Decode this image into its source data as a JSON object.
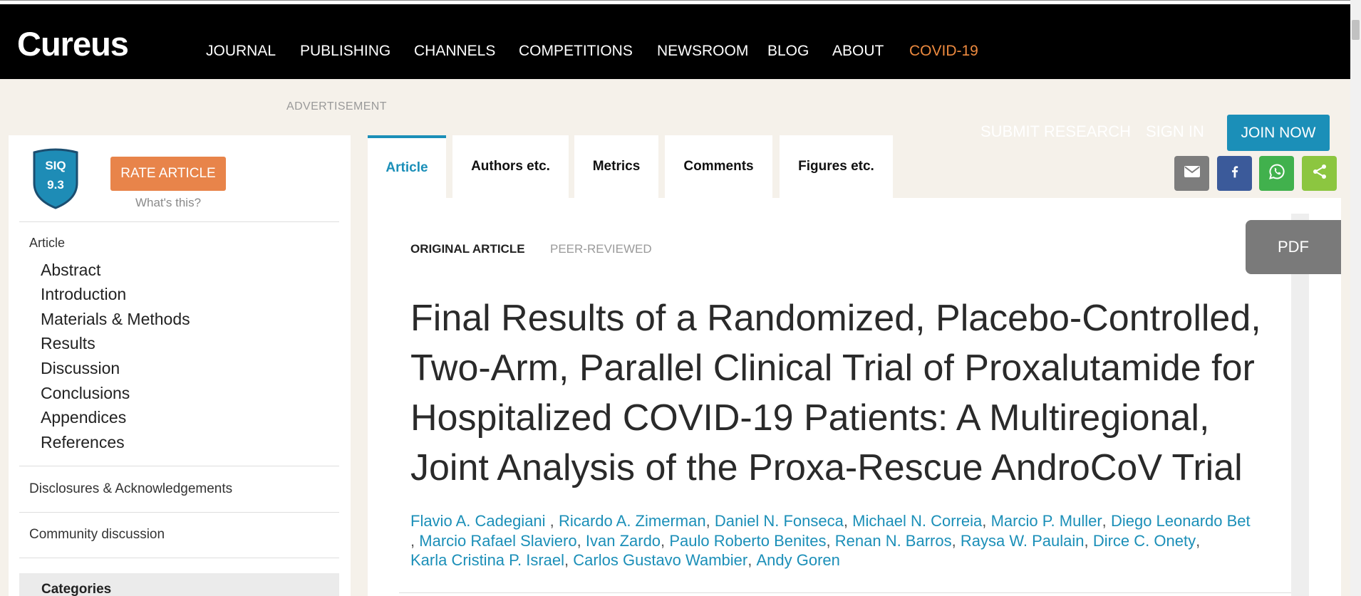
{
  "header": {
    "logo": "Cureus",
    "nav": [
      "JOURNAL",
      "PUBLISHING",
      "CHANNELS",
      "COMPETITIONS",
      "NEWSROOM",
      "BLOG",
      "ABOUT",
      "COVID-19"
    ]
  },
  "ad_label": "ADVERTISEMENT",
  "account": {
    "submit_research": "SUBMIT RESEARCH",
    "sign_in": "SIGN IN",
    "join_now": "JOIN NOW"
  },
  "share": [
    {
      "icon": "email-icon",
      "color": "#7d7d7d"
    },
    {
      "icon": "facebook-icon",
      "color": "#3b5a9a"
    },
    {
      "icon": "whatsapp-icon",
      "color": "#41b14d"
    },
    {
      "icon": "share-icon",
      "color": "#8cc640"
    }
  ],
  "pdf_label": "PDF",
  "sidebar": {
    "siq": {
      "label": "SIQ",
      "score": "9.3"
    },
    "rate_button": "RATE ARTICLE",
    "whats_this": "What's this?",
    "toc_heading": "Article",
    "toc_items": [
      "Abstract",
      "Introduction",
      "Materials & Methods",
      "Results",
      "Discussion",
      "Conclusions",
      "Appendices",
      "References"
    ],
    "links": [
      "Disclosures & Acknowledgements",
      "Community discussion"
    ],
    "categories_heading": "Categories"
  },
  "tabs": [
    {
      "label": "Article",
      "active": true
    },
    {
      "label": "Authors etc.",
      "active": false
    },
    {
      "label": "Metrics",
      "active": false
    },
    {
      "label": "Comments",
      "active": false
    },
    {
      "label": "Figures etc.",
      "active": false
    }
  ],
  "article": {
    "type": "ORIGINAL ARTICLE",
    "review_status": "PEER-REVIEWED",
    "title": "Final Results of a Randomized, Placebo-Controlled, Two-Arm, Parallel Clinical Trial of Proxalutamide for Hospitalized COVID-19 Patients: A Multiregional, Joint Analysis of the Proxa-Rescue AndroCoV Trial",
    "authors": [
      {
        "name": "Flavio A. Cadegiani",
        "sep": " ,"
      },
      {
        "name": "Ricardo A. Zimerman",
        "sep": ","
      },
      {
        "name": "Daniel N. Fonseca",
        "sep": ","
      },
      {
        "name": "Michael N. Correia",
        "sep": ","
      },
      {
        "name": "Marcio P. Muller",
        "sep": ","
      },
      {
        "name": "Diego Leonardo Bet",
        "sep": ","
      },
      {
        "name": "Marcio Rafael Slaviero",
        "sep": ","
      },
      {
        "name": "Ivan Zardo",
        "sep": ","
      },
      {
        "name": "Paulo Roberto Benites",
        "sep": ","
      },
      {
        "name": "Renan N. Barros",
        "sep": ","
      },
      {
        "name": "Raysa W. Paulain",
        "sep": ","
      },
      {
        "name": "Dirce C. Onety",
        "sep": ","
      },
      {
        "name": "Karla Cristina P. Israel",
        "sep": ","
      },
      {
        "name": "Carlos Gustavo Wambier",
        "sep": ","
      },
      {
        "name": "Andy Goren",
        "sep": ""
      }
    ]
  },
  "colors": {
    "accent": "#1b8fb8",
    "rate_button": "#e8844a",
    "covid_link": "#ed8a3f",
    "page_background": "#f5f1ea",
    "header_background": "#000000"
  }
}
